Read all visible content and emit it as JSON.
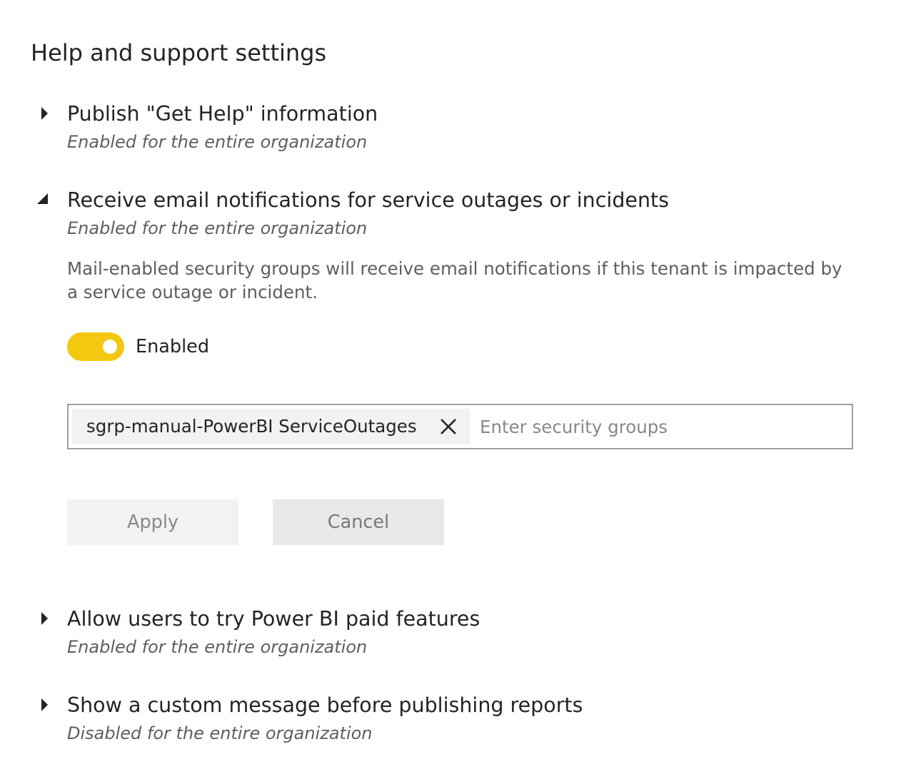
{
  "page": {
    "title": "Help and support settings"
  },
  "settings": [
    {
      "title": "Publish \"Get Help\" information",
      "status": "Enabled for the entire organization",
      "expanded": false
    },
    {
      "title": "Receive email notifications for service outages or incidents",
      "status": "Enabled for the entire organization",
      "expanded": true,
      "description": "Mail-enabled security groups will receive email notifications if this tenant is impacted by a service outage or incident.",
      "toggle": {
        "state": "on",
        "label": "Enabled",
        "color": "#f2c811"
      },
      "security_groups": {
        "selected": [
          "sgrp-manual-PowerBI ServiceOutages"
        ],
        "placeholder": "Enter security groups",
        "value": ""
      },
      "apply_label": "Apply",
      "cancel_label": "Cancel"
    },
    {
      "title": "Allow users to try Power BI paid features",
      "status": "Enabled for the entire organization",
      "expanded": false
    },
    {
      "title": "Show a custom message before publishing reports",
      "status": "Disabled for the entire organization",
      "expanded": false
    }
  ],
  "icons": {
    "collapsed": "caret-right-icon",
    "expanded": "caret-down-right-icon",
    "remove": "close-icon"
  }
}
